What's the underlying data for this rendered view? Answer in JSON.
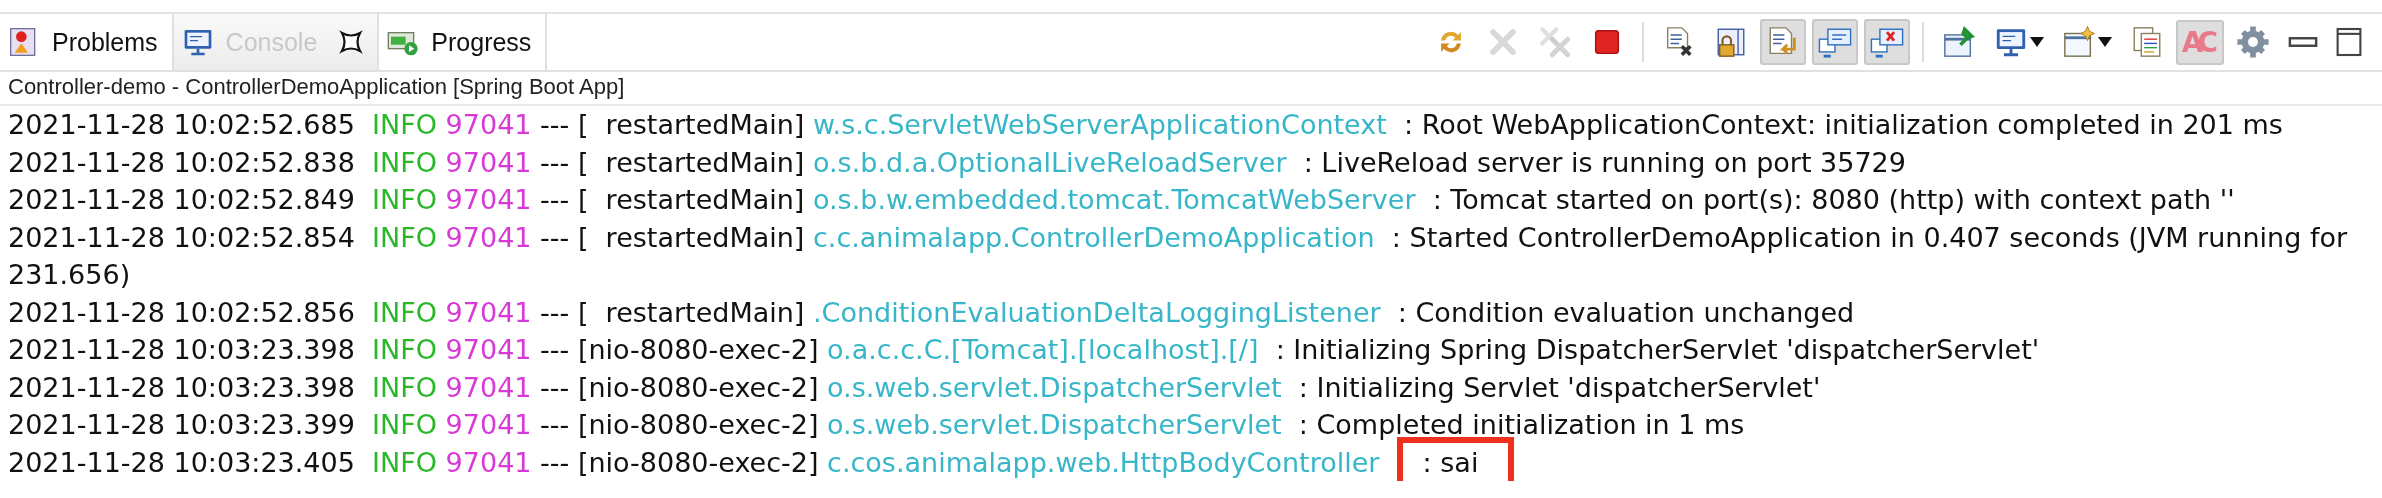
{
  "tabs": [
    {
      "label": "Problems",
      "selected": false,
      "closable": false
    },
    {
      "label": "Console",
      "selected": true,
      "closable": true
    },
    {
      "label": "Progress",
      "selected": false,
      "closable": false
    }
  ],
  "toolbar": [
    {
      "pressed": false,
      "disabled": false,
      "menu": false
    },
    {
      "pressed": false,
      "disabled": true,
      "menu": false
    },
    {
      "pressed": false,
      "disabled": true,
      "menu": false
    },
    {
      "pressed": false,
      "disabled": false,
      "menu": false
    },
    {
      "pressed": false,
      "disabled": false,
      "menu": false
    },
    {
      "pressed": false,
      "disabled": false,
      "menu": false
    },
    {
      "pressed": true,
      "disabled": false,
      "menu": false
    },
    {
      "pressed": true,
      "disabled": false,
      "menu": false
    },
    {
      "pressed": true,
      "disabled": false,
      "menu": false
    },
    {
      "pressed": false,
      "disabled": false,
      "menu": false
    },
    {
      "pressed": false,
      "disabled": false,
      "menu": true
    },
    {
      "pressed": false,
      "disabled": false,
      "menu": true
    },
    {
      "pressed": false,
      "disabled": false,
      "menu": false
    },
    {
      "pressed": true,
      "disabled": false,
      "menu": false,
      "label": "AC"
    },
    {
      "pressed": false,
      "disabled": false,
      "menu": false
    },
    {
      "pressed": false,
      "disabled": false,
      "menu": false
    },
    {
      "pressed": false,
      "disabled": false,
      "menu": false
    }
  ],
  "console_title": "Controller-demo - ControllerDemoApplication [Spring Boot App]",
  "log_lines": [
    {
      "timestamp": "2021-11-28 10:02:52.685",
      "level": "INFO",
      "pid": "97041",
      "separator": "---",
      "thread": "[  restartedMain]",
      "logger": "w.s.c.ServletWebServerApplicationContext",
      "message": ": Root WebApplicationContext: initialization completed in 201 ms",
      "highlighted": false
    },
    {
      "timestamp": "2021-11-28 10:02:52.838",
      "level": "INFO",
      "pid": "97041",
      "separator": "---",
      "thread": "[  restartedMain]",
      "logger": "o.s.b.d.a.OptionalLiveReloadServer",
      "message": ": LiveReload server is running on port 35729",
      "highlighted": false
    },
    {
      "timestamp": "2021-11-28 10:02:52.849",
      "level": "INFO",
      "pid": "97041",
      "separator": "---",
      "thread": "[  restartedMain]",
      "logger": "o.s.b.w.embedded.tomcat.TomcatWebServer",
      "message": ": Tomcat started on port(s): 8080 (http) with context path ''",
      "highlighted": false
    },
    {
      "timestamp": "2021-11-28 10:02:52.854",
      "level": "INFO",
      "pid": "97041",
      "separator": "---",
      "thread": "[  restartedMain]",
      "logger": "c.c.animalapp.ControllerDemoApplication",
      "message": ": Started ControllerDemoApplication in 0.407 seconds (JVM running for",
      "continuation": "231.656)",
      "highlighted": false
    },
    {
      "timestamp": "2021-11-28 10:02:52.856",
      "level": "INFO",
      "pid": "97041",
      "separator": "---",
      "thread": "[  restartedMain]",
      "logger": ".ConditionEvaluationDeltaLoggingListener",
      "message": ": Condition evaluation unchanged",
      "highlighted": false
    },
    {
      "timestamp": "2021-11-28 10:03:23.398",
      "level": "INFO",
      "pid": "97041",
      "separator": "---",
      "thread": "[nio-8080-exec-2]",
      "logger": "o.a.c.c.C.[Tomcat].[localhost].[/]",
      "message": ": Initializing Spring DispatcherServlet 'dispatcherServlet'",
      "highlighted": false
    },
    {
      "timestamp": "2021-11-28 10:03:23.398",
      "level": "INFO",
      "pid": "97041",
      "separator": "---",
      "thread": "[nio-8080-exec-2]",
      "logger": "o.s.web.servlet.DispatcherServlet",
      "message": ": Initializing Servlet 'dispatcherServlet'",
      "highlighted": false
    },
    {
      "timestamp": "2021-11-28 10:03:23.399",
      "level": "INFO",
      "pid": "97041",
      "separator": "---",
      "thread": "[nio-8080-exec-2]",
      "logger": "o.s.web.servlet.DispatcherServlet",
      "message": ": Completed initialization in 1 ms",
      "highlighted": false
    },
    {
      "timestamp": "2021-11-28 10:03:23.405",
      "level": "INFO",
      "pid": "97041",
      "separator": "---",
      "thread": "[nio-8080-exec-2]",
      "logger": "c.cos.animalapp.web.HttpBodyController",
      "message": ": sai",
      "highlighted": true
    }
  ]
}
